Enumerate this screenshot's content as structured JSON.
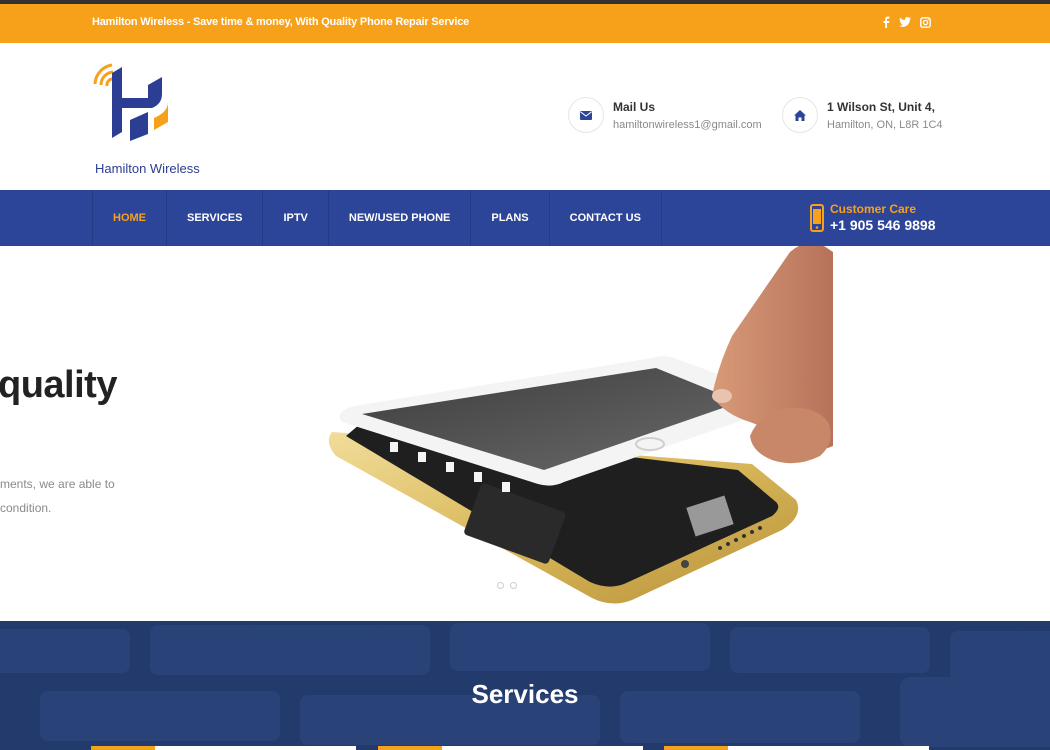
{
  "topbar": {
    "tagline": "Hamilton Wireless - Save time & money, With Quality Phone Repair Service",
    "social": [
      "facebook-icon",
      "twitter-icon",
      "instagram-icon"
    ]
  },
  "logo": {
    "text": "Hamilton Wireless"
  },
  "header": {
    "mail": {
      "title": "Mail Us",
      "value": "hamiltonwireless1@gmail.com",
      "icon": "envelope-icon"
    },
    "address": {
      "title": "1 Wilson St, Unit 4,",
      "value": "Hamilton, ON, L8R 1C4",
      "icon": "home-icon"
    }
  },
  "nav": {
    "items": [
      {
        "label": "HOME",
        "active": true
      },
      {
        "label": "SERVICES"
      },
      {
        "label": "IPTV"
      },
      {
        "label": "NEW/USED PHONE"
      },
      {
        "label": "PLANS"
      },
      {
        "label": "CONTACT US"
      }
    ],
    "care": {
      "title": "Customer Care",
      "phone": "+1 905 546 9898",
      "icon": "mobile-phone-icon"
    }
  },
  "hero": {
    "heading": "quality",
    "text_line1": "ments, we are able to",
    "text_line2": "condition.",
    "image": "phone-screen-repair-photo"
  },
  "services": {
    "title": "Services"
  },
  "colors": {
    "accent": "#f7a11a",
    "nav": "#2d4598",
    "brand_blue": "#2c3e93",
    "services_bg": "#233a6c"
  }
}
